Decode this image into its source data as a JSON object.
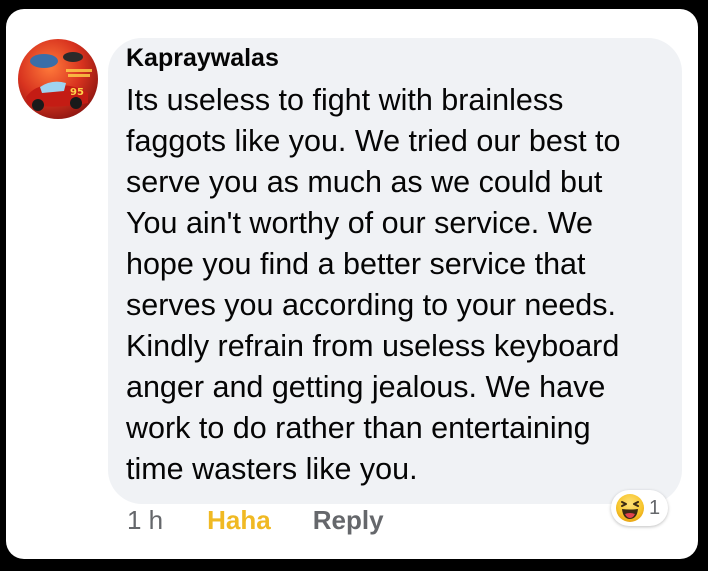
{
  "comment": {
    "author": "Kapraywalas",
    "lines": [
      "Its useless to fight with brainless",
      "faggots like you. We tried our best to",
      "serve you as much as we could but",
      "You ain't worthy of our service. We",
      "hope you find a better service that",
      "serves you according to your needs.",
      "Kindly refrain from useless keyboard",
      "anger and getting jealous. We have",
      "work to do rather than entertaining",
      "time wasters like you."
    ]
  },
  "actions": {
    "time": "1 h",
    "haha_label": "Haha",
    "reply_label": "Reply"
  },
  "reaction": {
    "icon": "haha-emoji",
    "count": "1"
  },
  "colors": {
    "bubble": "#f0f2f5",
    "text": "#050505",
    "muted": "#65676b",
    "haha": "#f0b923",
    "frame_border": "#000000"
  }
}
